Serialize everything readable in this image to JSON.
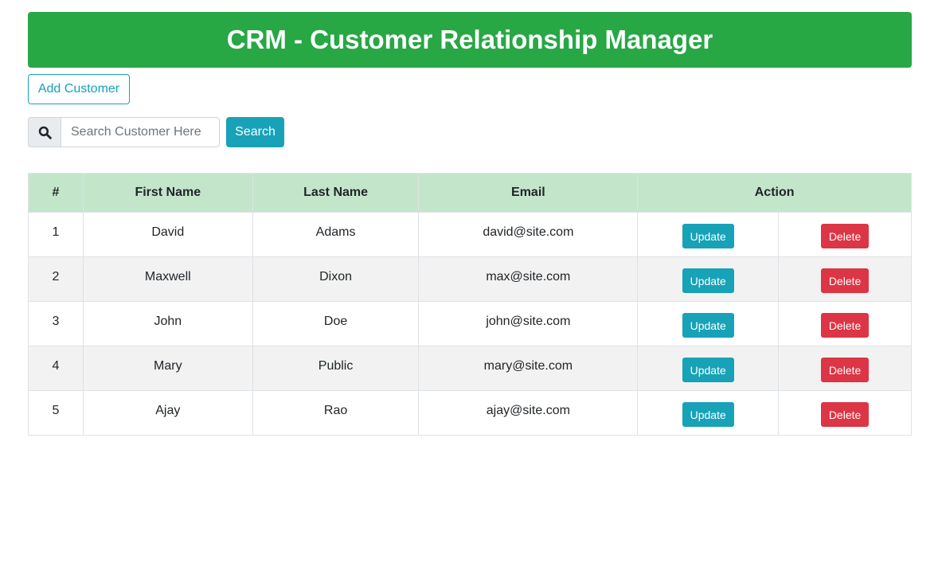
{
  "header": {
    "title": "CRM - Customer Relationship Manager"
  },
  "toolbar": {
    "add_label": "Add Customer"
  },
  "search": {
    "placeholder": "Search Customer Here",
    "value": "",
    "button_label": "Search",
    "icon": "search-icon"
  },
  "colors": {
    "header": "#28a745",
    "table_header": "#c3e6cb",
    "accent": "#17a2b8",
    "danger": "#dc3545"
  },
  "table": {
    "columns": [
      "#",
      "First Name",
      "Last Name",
      "Email",
      "Action"
    ],
    "update_label": "Update",
    "delete_label": "Delete",
    "rows": [
      {
        "num": "1",
        "first": "David",
        "last": "Adams",
        "email": "david@site.com"
      },
      {
        "num": "2",
        "first": "Maxwell",
        "last": "Dixon",
        "email": "max@site.com"
      },
      {
        "num": "3",
        "first": "John",
        "last": "Doe",
        "email": "john@site.com"
      },
      {
        "num": "4",
        "first": "Mary",
        "last": "Public",
        "email": "mary@site.com"
      },
      {
        "num": "5",
        "first": "Ajay",
        "last": "Rao",
        "email": "ajay@site.com"
      }
    ]
  }
}
